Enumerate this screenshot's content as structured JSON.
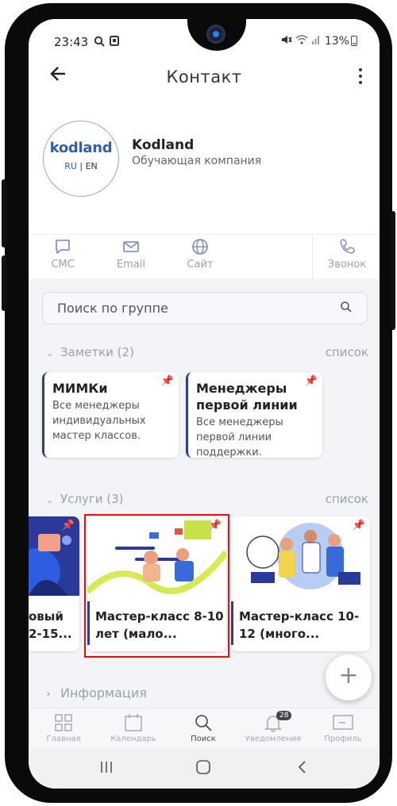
{
  "status_bar": {
    "time": "23:43",
    "left_icons": [
      "search-icon",
      "square-icon"
    ],
    "right_icons": [
      "mute-icon",
      "wifi-icon",
      "signal-icon"
    ],
    "battery_percent": "13%"
  },
  "app_bar": {
    "title": "Контакт"
  },
  "profile": {
    "logo_text": "kodland",
    "logo_lang_ru": "RU",
    "logo_lang_sep": " | ",
    "logo_lang_en": "EN",
    "name": "Kodland",
    "subtitle": "Обучающая компания"
  },
  "actions": [
    {
      "label": "СМС",
      "icon": "chat-icon"
    },
    {
      "label": "Email",
      "icon": "mail-icon"
    },
    {
      "label": "Сайт",
      "icon": "globe-icon"
    },
    {
      "label": "Звонок",
      "icon": "phone-icon"
    }
  ],
  "search": {
    "placeholder": "Поиск по группе"
  },
  "notes_section": {
    "label": "Заметки (2)",
    "link": "список",
    "cards": [
      {
        "title": "МИМКи",
        "text": "Все менеджеры индивидуальных мастер классов."
      },
      {
        "title": "Менеджеры первой линии",
        "text": "Все менеджеры первой линии поддержки."
      }
    ]
  },
  "services_section": {
    "label": "Услуги (3)",
    "link": "список",
    "cards": [
      {
        "title_line1": "овый",
        "title_line2": "2-15..."
      },
      {
        "title_line1": "Мастер-класс 8-10",
        "title_line2": "лет (мало..."
      },
      {
        "title_line1": "Мастер-класс 10-",
        "title_line2": "12 (много..."
      }
    ]
  },
  "info_section": {
    "label": "Информация"
  },
  "fab": {
    "symbol": "+"
  },
  "tab_bar": {
    "items": [
      {
        "label": "Главная",
        "icon": "grid-icon",
        "active": false
      },
      {
        "label": "Календарь",
        "icon": "calendar-icon",
        "active": false
      },
      {
        "label": "Поиск",
        "icon": "search-icon",
        "active": true
      },
      {
        "label": "Уведомления",
        "icon": "bell-icon",
        "active": false,
        "badge": "28"
      },
      {
        "label": "Профиль",
        "icon": "profile-card-icon",
        "active": false
      }
    ]
  },
  "colors": {
    "brand": "#2e5fb3",
    "accent_bar": "#2f3f8a",
    "highlight": "#e01010"
  }
}
